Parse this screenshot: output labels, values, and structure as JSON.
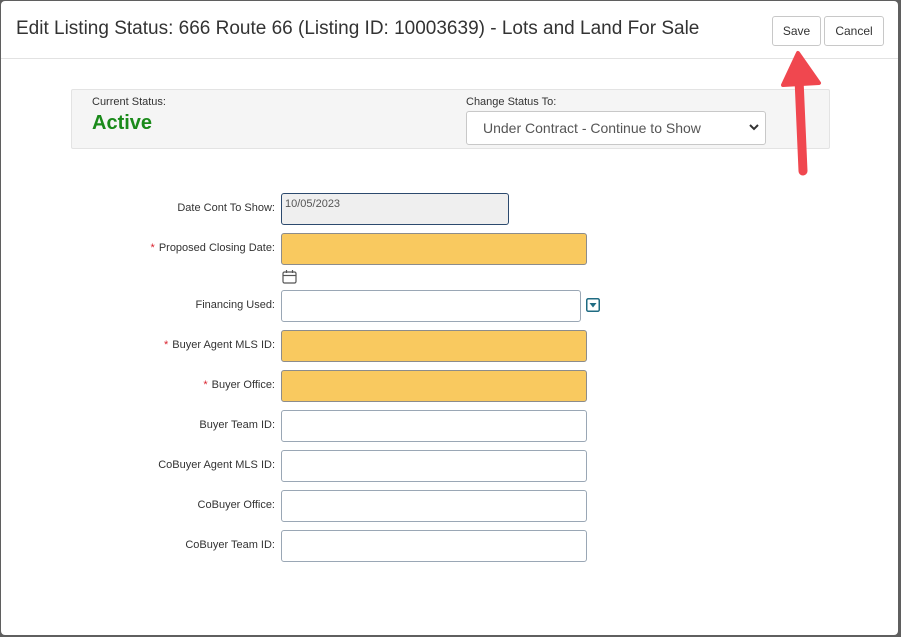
{
  "dialog": {
    "title": "Edit Listing Status: 666 Route 66 (Listing ID: 10003639) - Lots and Land For Sale",
    "save_label": "Save",
    "cancel_label": "Cancel"
  },
  "status": {
    "current_label": "Current Status:",
    "current_value": "Active",
    "current_value_color": "#1a8a1a",
    "change_label": "Change Status To:",
    "change_selected": "Under Contract - Continue to Show"
  },
  "form": {
    "required_marker": "*",
    "date_cont_label": "Date Cont To Show:",
    "date_cont_value": "10/05/2023",
    "proposed_closing_label": "Proposed Closing Date:",
    "proposed_closing_value": "",
    "financing_label": "Financing Used:",
    "financing_value": "",
    "buyer_agent_label": "Buyer Agent MLS ID:",
    "buyer_agent_value": "",
    "buyer_office_label": "Buyer Office:",
    "buyer_office_value": "",
    "buyer_team_label": "Buyer Team ID:",
    "buyer_team_value": "",
    "cobuyer_agent_label": "CoBuyer Agent MLS ID:",
    "cobuyer_agent_value": "",
    "cobuyer_office_label": "CoBuyer Office:",
    "cobuyer_office_value": "",
    "cobuyer_team_label": "CoBuyer Team ID:",
    "cobuyer_team_value": ""
  },
  "icons": {
    "calendar": "calendar-icon",
    "dropdown": "dropdown-toggle-icon",
    "annotation": "red-arrow-annotation"
  },
  "colors": {
    "required_field_bg": "#f9c95f",
    "required_marker": "#d9232e",
    "annotation_arrow": "#f0474f"
  }
}
